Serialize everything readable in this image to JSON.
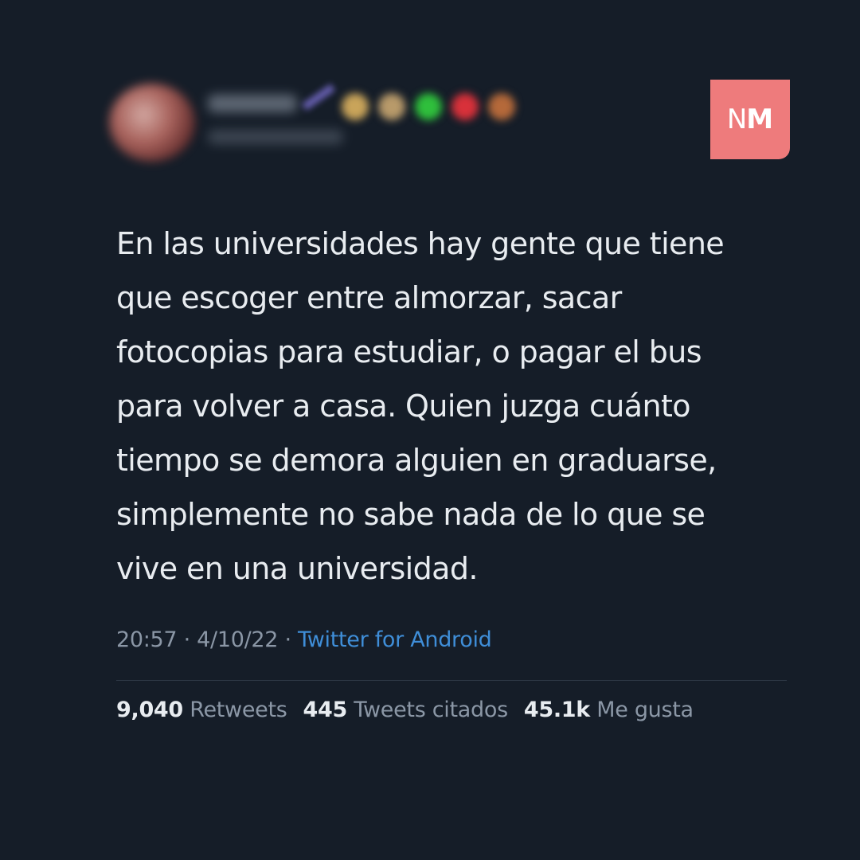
{
  "author": {
    "emojis": [
      {
        "name": "gold-emoji-icon",
        "color": "#c9a45a"
      },
      {
        "name": "gold-emoji-icon",
        "color": "#b89a6a"
      },
      {
        "name": "green-heart-icon",
        "color": "#2fbf3c"
      },
      {
        "name": "red-heart-icon",
        "color": "#d8313a"
      },
      {
        "name": "orange-emoji-icon",
        "color": "#b5693a"
      }
    ]
  },
  "logo": {
    "letter_n": "N",
    "letter_m": "M",
    "color": "#ee7b7c"
  },
  "tweet": {
    "text": "En las universidades hay gente que tiene\nque escoger entre almorzar, sacar\nfotocopias para estudiar, o pagar el bus\npara volver a casa. Quien juzga cuánto\ntiempo se demora alguien en graduarse,\nsimplemente no sabe nada de lo que se\nvive en una universidad."
  },
  "meta": {
    "time": "20:57",
    "separator": " · ",
    "date": "4/10/22",
    "source": "Twitter for Android"
  },
  "stats": {
    "retweets_count": "9,040",
    "retweets_label": "Retweets",
    "quotes_count": "445",
    "quotes_label": "Tweets citados",
    "likes_count": "45.1k",
    "likes_label": "Me gusta"
  },
  "colors": {
    "background": "#151d28",
    "text": "#e8ecf0",
    "muted": "#8b97a6",
    "link": "#3f8ed8"
  }
}
